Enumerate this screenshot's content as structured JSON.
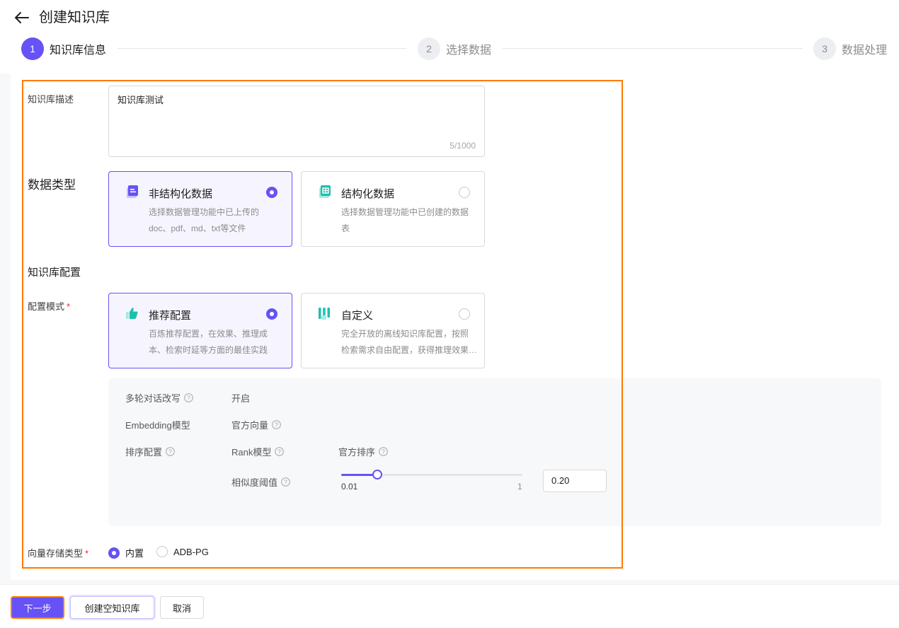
{
  "header": {
    "title": "创建知识库"
  },
  "steps": [
    {
      "num": "1",
      "label": "知识库信息",
      "active": true
    },
    {
      "num": "2",
      "label": "选择数据",
      "active": false
    },
    {
      "num": "3",
      "label": "数据处理",
      "active": false
    }
  ],
  "description": {
    "label": "知识库描述",
    "value": "知识库测试",
    "counter": "5/1000"
  },
  "data_type": {
    "title": "数据类型",
    "options": [
      {
        "title": "非结构化数据",
        "desc_line1": "选择数据管理功能中已上传的",
        "desc_line2": "doc、pdf、md、txt等文件",
        "selected": true,
        "icon": "document-icon"
      },
      {
        "title": "结构化数据",
        "desc_line1": "选择数据管理功能中已创建的数据",
        "desc_line2": "表",
        "selected": false,
        "icon": "table-icon"
      }
    ]
  },
  "kb_config": {
    "title": "知识库配置",
    "mode_label": "配置模式",
    "required_mark": "*",
    "modes": [
      {
        "title": "推荐配置",
        "desc_line1": "百炼推荐配置，在效果、推理成",
        "desc_line2": "本、检索时延等方面的最佳实践",
        "selected": true,
        "icon": "thumbs-up-icon"
      },
      {
        "title": "自定义",
        "desc_line1": "完全开放的离线知识库配置，按照",
        "desc_line2": "检索需求自由配置，获得推理效果最佳实践",
        "selected": false,
        "icon": "custom-bars-icon"
      }
    ]
  },
  "config_details": {
    "multi_turn_label": "多轮对话改写",
    "multi_turn_value": "开启",
    "embedding_label": "Embedding模型",
    "embedding_value": "官方向量",
    "rank_config_label": "排序配置",
    "rank_model_label": "Rank模型",
    "rank_model_value": "官方排序",
    "similarity_label": "相似度阈值",
    "similarity": {
      "min": "0.01",
      "max": "1",
      "value": "0.20",
      "fraction": 0.2
    }
  },
  "vector_storage": {
    "label": "向量存储类型",
    "required_mark": "*",
    "options": [
      {
        "label": "内置",
        "selected": true
      },
      {
        "label": "ADB-PG",
        "selected": false
      }
    ]
  },
  "footer": {
    "next_label": "下一步",
    "create_empty_label": "创建空知识库",
    "cancel_label": "取消"
  },
  "colors": {
    "accent": "#6652f5",
    "highlight": "#ff7a00",
    "teal_icon": "#1fbfae"
  }
}
